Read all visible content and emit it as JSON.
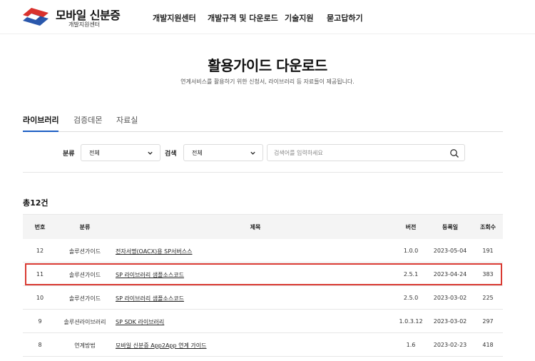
{
  "header": {
    "logo_title": "모바일 신분증",
    "logo_sub": "개발지원센터",
    "nav": [
      "개발지원센터",
      "개발규격 및 다운로드",
      "기술지원",
      "묻고답하기"
    ]
  },
  "page": {
    "title": "활용가이드 다운로드",
    "description": "연계서비스를 활용하기 위한 신청서, 라이브러리 등 자료들이 제공됩니다."
  },
  "tabs": [
    {
      "label": "라이브러리",
      "active": true
    },
    {
      "label": "검증데몬",
      "active": false
    },
    {
      "label": "자료실",
      "active": false
    }
  ],
  "filter": {
    "category_label": "분류",
    "category_value": "전체",
    "search_label": "검색",
    "search_value": "전체",
    "search_placeholder": "검색어를 입력하세요"
  },
  "list": {
    "total": "총12건",
    "columns": [
      "번호",
      "분류",
      "제목",
      "버전",
      "등록일",
      "조회수"
    ],
    "rows": [
      {
        "no": "12",
        "category": "솔루션가이드",
        "title": "전자서명(OACX)용 SP서버스스",
        "version": "1.0.0",
        "date": "2023-05-04",
        "views": "191"
      },
      {
        "no": "11",
        "category": "솔루션가이드",
        "title": "SP 라이브러리 샘플소스코드",
        "version": "2.5.1",
        "date": "2023-04-24",
        "views": "383"
      },
      {
        "no": "10",
        "category": "솔루션가이드",
        "title": "SP 라이브러리 샘플소스코드",
        "version": "2.5.0",
        "date": "2023-03-02",
        "views": "225"
      },
      {
        "no": "9",
        "category": "솔루션라이브러리",
        "title": "SP SDK 라이브러리",
        "version": "1.0.3.12",
        "date": "2023-03-02",
        "views": "297"
      },
      {
        "no": "8",
        "category": "연계방법",
        "title": "모바일 신분증 App2App 연계 가이드",
        "version": "1.6",
        "date": "2023-02-23",
        "views": "418"
      }
    ]
  },
  "colors": {
    "accent": "#1c5fc4",
    "highlight": "#d93a32",
    "logo_red": "#d9322d",
    "logo_blue": "#1f4fa8"
  }
}
